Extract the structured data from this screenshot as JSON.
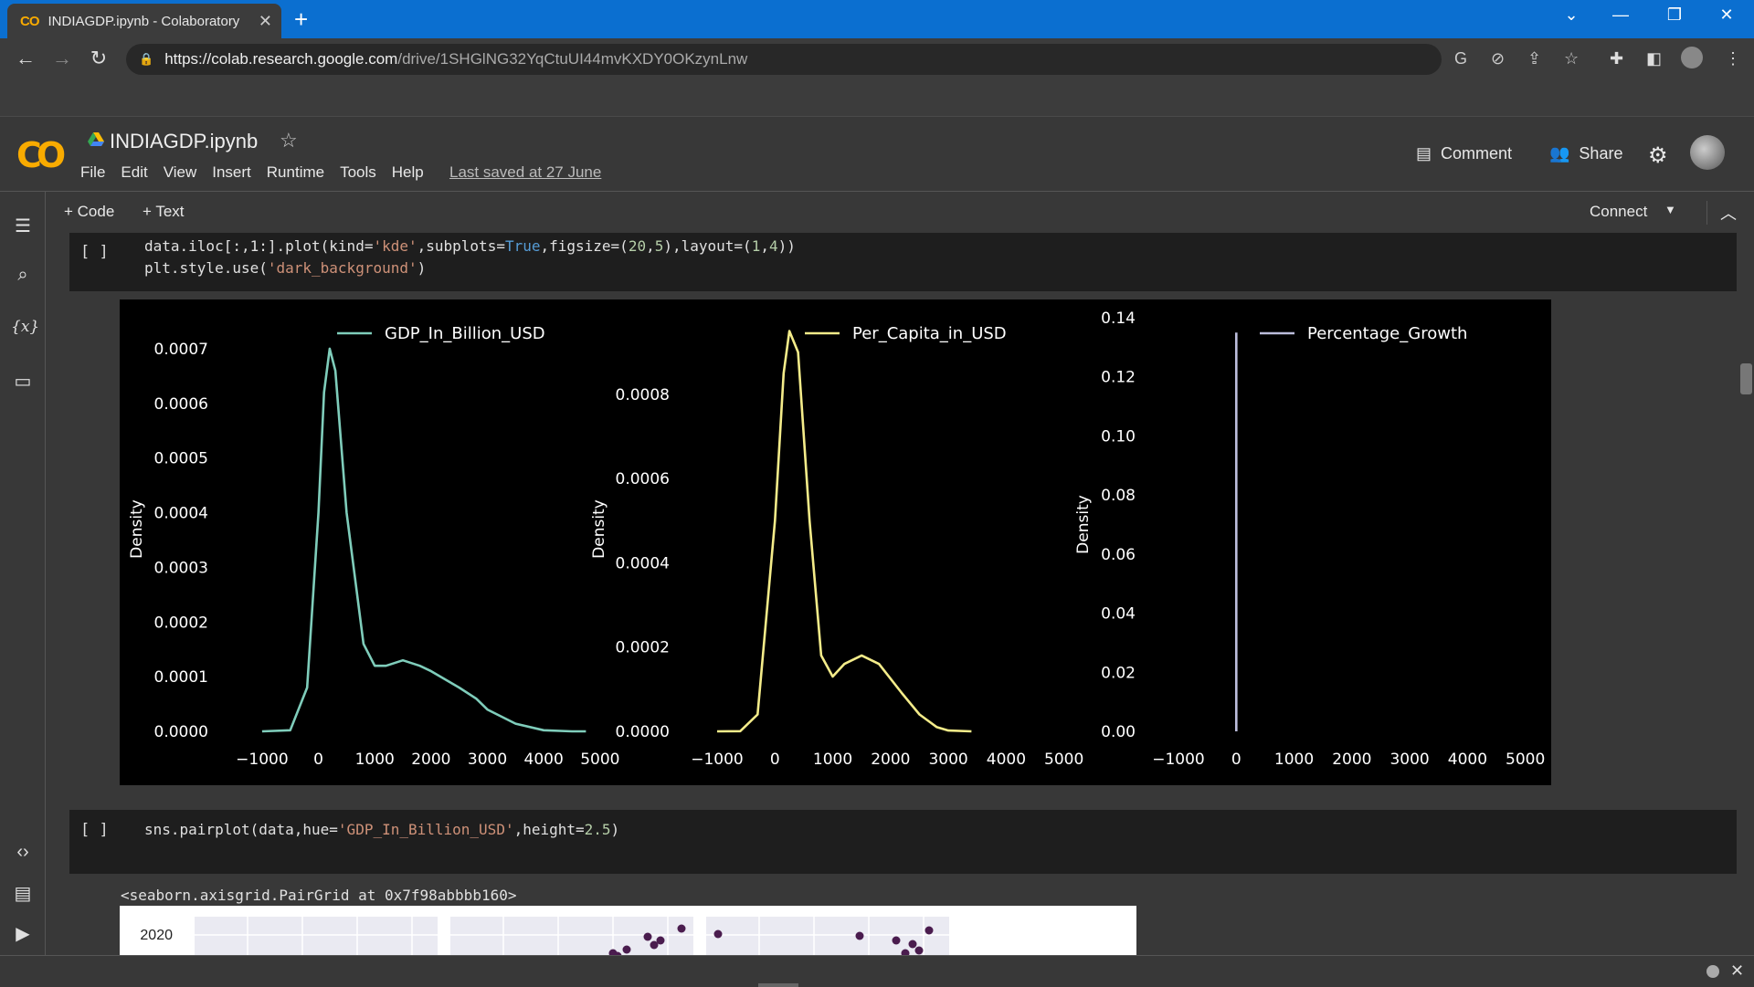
{
  "browser": {
    "tab_title": "INDIAGDP.ipynb - Colaboratory",
    "tab_logo": "CO",
    "tab_close": "✕",
    "new_tab": "+",
    "url_host": "https://colab.research.google.com",
    "url_path": "/drive/1SHGlNG32YqCtuUI44mvKXDY0OKzynLnw",
    "window_controls": [
      "⌄",
      "—",
      "❐",
      "✕"
    ]
  },
  "colab": {
    "logo": "CO",
    "notebook_title": "INDIAGDP.ipynb",
    "menu": [
      "File",
      "Edit",
      "View",
      "Insert",
      "Runtime",
      "Tools",
      "Help"
    ],
    "last_saved": "Last saved at 27 June",
    "comment": "Comment",
    "share": "Share",
    "add_code": "+ Code",
    "add_text": "+ Text",
    "connect": "Connect"
  },
  "cells": [
    {
      "run_label": "[ ]",
      "code": [
        "data.iloc[:,1:].plot(kind='kde',subplots=True,figsize=(20,5),layout=(1,4))",
        "plt.style.use('dark_background')"
      ]
    },
    {
      "run_label": "[ ]",
      "code": [
        "sns.pairplot(data,hue='GDP_In_Billion_USD',height=2.5)"
      ],
      "output_text": "<seaborn.axisgrid.PairGrid at 0x7f98abbbb160>",
      "pair_tick": "2020"
    }
  ],
  "chart_data": [
    {
      "type": "line",
      "title": "",
      "xlabel": "",
      "ylabel": "Density",
      "series": [
        {
          "name": "GDP_In_Billion_USD",
          "color": "#7fcdbb",
          "x": [
            -1000,
            -500,
            -200,
            0,
            100,
            200,
            300,
            500,
            800,
            1000,
            1200,
            1500,
            1800,
            2000,
            2500,
            2800,
            3000,
            3500,
            4000,
            4500,
            4750
          ],
          "y": [
            0.0,
            2e-06,
            8e-05,
            0.0004,
            0.00062,
            0.0007,
            0.00066,
            0.0004,
            0.00016,
            0.00012,
            0.00012,
            0.00013,
            0.00012,
            0.00011,
            8e-05,
            6e-05,
            4e-05,
            1.4e-05,
            2e-06,
            0.0,
            0.0
          ]
        }
      ],
      "xticks": [
        -1000,
        0,
        1000,
        2000,
        3000,
        4000,
        5000
      ],
      "yticks": [
        "0.0000",
        "0.0001",
        "0.0002",
        "0.0003",
        "0.0004",
        "0.0005",
        "0.0006",
        "0.0007"
      ],
      "xlim": [
        -1550,
        5100
      ],
      "ylim": [
        0,
        0.00074
      ],
      "legend": "top-right"
    },
    {
      "type": "line",
      "title": "",
      "xlabel": "",
      "ylabel": "Density",
      "series": [
        {
          "name": "Per_Capita_in_USD",
          "color": "#f4ec8a",
          "x": [
            -1000,
            -600,
            -300,
            0,
            150,
            250,
            400,
            600,
            800,
            1000,
            1200,
            1500,
            1800,
            2200,
            2500,
            2800,
            3000,
            3400
          ],
          "y": [
            0.0,
            4e-07,
            4e-05,
            0.0005,
            0.00085,
            0.00095,
            0.0009,
            0.0005,
            0.00018,
            0.00013,
            0.00016,
            0.00018,
            0.00016,
            9e-05,
            4e-05,
            1e-05,
            2e-06,
            0.0
          ]
        }
      ],
      "xticks": [
        -1000,
        0,
        1000,
        2000,
        3000,
        4000,
        5000
      ],
      "yticks": [
        "0.0000",
        "0.0002",
        "0.0004",
        "0.0006",
        "0.0008"
      ],
      "xlim": [
        -1300,
        5100
      ],
      "ylim": [
        0,
        0.00096
      ],
      "legend": "top-right"
    },
    {
      "type": "line",
      "title": "",
      "xlabel": "",
      "ylabel": "Density",
      "series": [
        {
          "name": "Percentage_Growth",
          "color": "#bcbddc",
          "x": [
            0,
            0
          ],
          "y": [
            0.0,
            0.135
          ]
        }
      ],
      "xticks": [
        -1000,
        0,
        1000,
        2000,
        3000,
        4000,
        5000
      ],
      "yticks": [
        "0.00",
        "0.02",
        "0.04",
        "0.06",
        "0.08",
        "0.10",
        "0.12",
        "0.14"
      ],
      "xlim": [
        -1300,
        5100
      ],
      "ylim": [
        0,
        0.14
      ],
      "legend": "top-right"
    }
  ]
}
